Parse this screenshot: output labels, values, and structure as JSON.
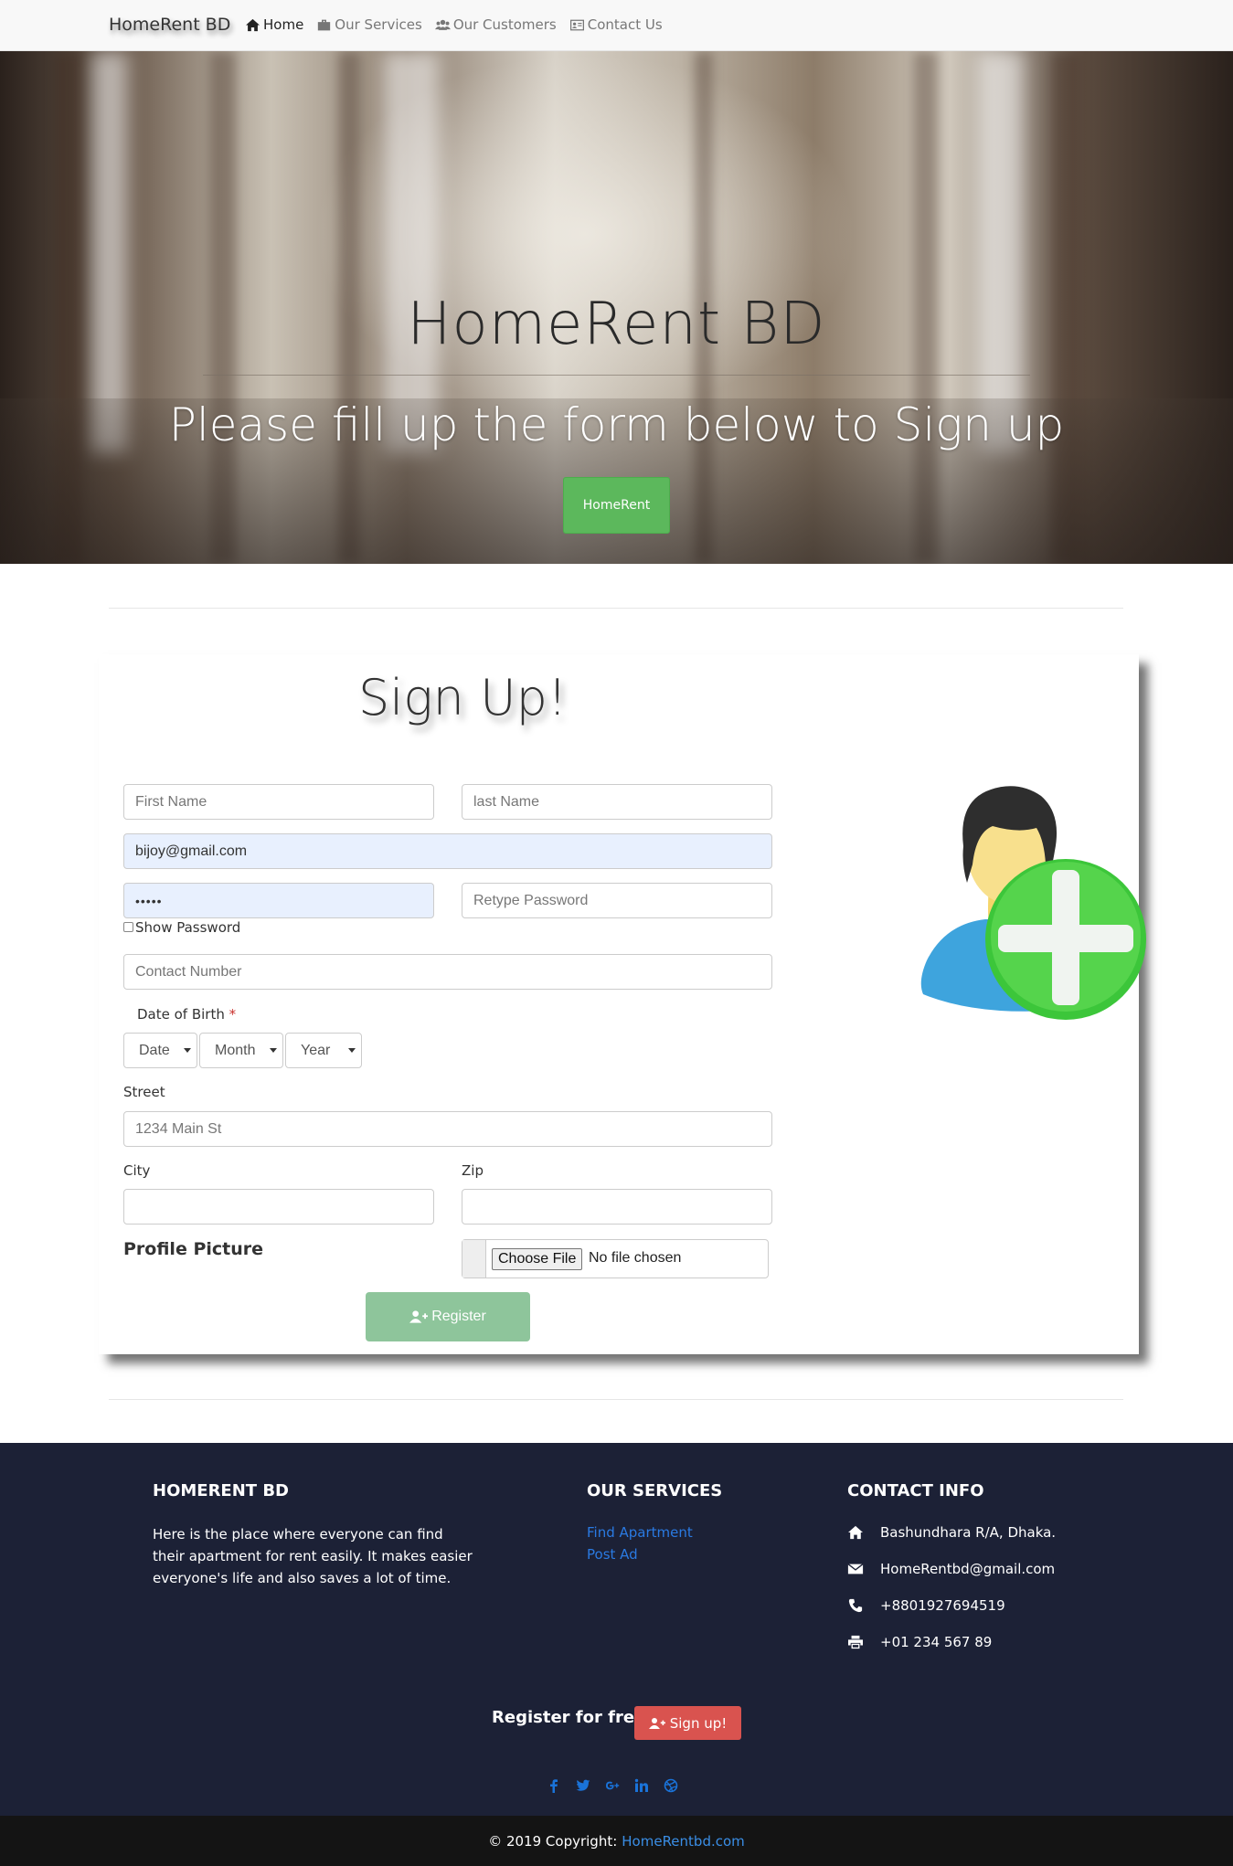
{
  "nav": {
    "brand": "HomeRent BD",
    "items": [
      {
        "label": "Home",
        "icon": "home-icon",
        "active": true
      },
      {
        "label": "Our Services",
        "icon": "briefcase-icon"
      },
      {
        "label": "Our Customers",
        "icon": "users-icon"
      },
      {
        "label": "Contact Us",
        "icon": "contact-card-icon"
      }
    ]
  },
  "hero": {
    "title": "HomeRent BD",
    "subtitle": "Please fill up the form below to Sign up",
    "button_label": "HomeRent"
  },
  "form": {
    "title": "Sign Up!",
    "first_name_placeholder": "First Name",
    "last_name_placeholder": "last Name",
    "email_value": "bijoy@gmail.com",
    "password_value": "•••••",
    "retype_password_placeholder": "Retype Password",
    "show_password_label": "Show Password",
    "contact_placeholder": "Contact Number",
    "dob_label": "Date of Birth",
    "dob_required": "*",
    "dob_date": "Date",
    "dob_month": "Month",
    "dob_year": "Year",
    "street_label": "Street",
    "street_placeholder": "1234 Main St",
    "city_label": "City",
    "zip_label": "Zip",
    "profile_picture_label": "Profile Picture",
    "choose_file_label": "Choose File",
    "no_file_label": "No file chosen",
    "register_label": "Register"
  },
  "footer": {
    "about_heading": "HOMERENT BD",
    "about_text": "Here is the place where everyone can find their apartment for rent easily. It makes easier everyone's life and also saves a lot of time.",
    "services_heading": "OUR SERVICES",
    "services": [
      "Find Apartment",
      "Post Ad"
    ],
    "contact_heading": "CONTACT INFO",
    "address": "Bashundhara R/A, Dhaka.",
    "email": "HomeRentbd@gmail.com",
    "phone": "+8801927694519",
    "fax": "+01 234 567 89",
    "register_text": "Register for free",
    "signup_label": "Sign up!",
    "social": [
      "facebook-icon",
      "twitter-icon",
      "google-plus-icon",
      "linkedin-icon",
      "dribbble-icon"
    ],
    "copyright_prefix": "© 2019 Copyright:",
    "copyright_link": "HomeRentbd.com"
  },
  "colors": {
    "success_green": "#5cb85c",
    "register_green": "#8ec59b",
    "footer_bg": "#1c2136",
    "link_blue": "#2a7ae2",
    "danger_red": "#d9534f"
  }
}
